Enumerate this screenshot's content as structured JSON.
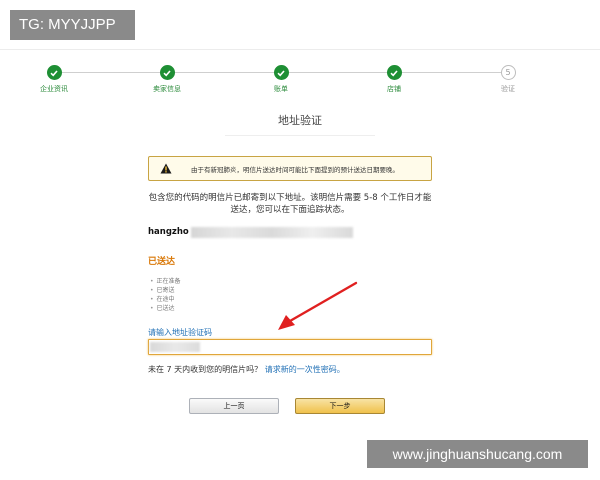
{
  "tg_badge": "TG: MYYJJPP",
  "steps": [
    {
      "label": "企业资讯",
      "state": "done"
    },
    {
      "label": "卖家信息",
      "state": "done"
    },
    {
      "label": "账单",
      "state": "done"
    },
    {
      "label": "店铺",
      "state": "done"
    },
    {
      "label": "验证",
      "state": "todo",
      "number": "5"
    }
  ],
  "section_title": "地址验证",
  "alert": {
    "text": "由于有新冠肺炎，明信片送达时间可能比下面提到的预计送达日期要晚。",
    "icon": "warning-icon",
    "color": "#c8a443"
  },
  "paragraph": "包含您的代码的明信片已邮寄到以下地址。该明信片需要 5-8 个工作日才能送达，您可以在下面追踪状态。",
  "address_visible": "hangzho",
  "status": {
    "heading": "已送达",
    "items": [
      "正在准备",
      "已寄送",
      "在途中",
      "已送达"
    ]
  },
  "code": {
    "label": "请输入地址验证码",
    "value": ""
  },
  "help": {
    "text": "未在 7 天内收到您的明信片吗？",
    "link": "请求新的一次性密码。"
  },
  "buttons": {
    "prev": "上一页",
    "next": "下一步"
  },
  "watermark": "www.jinghuanshucang.com",
  "colors": {
    "step_done": "#1e8f34",
    "link": "#1f6fb5",
    "status_heading": "#d97706",
    "arrow": "#e02020"
  }
}
